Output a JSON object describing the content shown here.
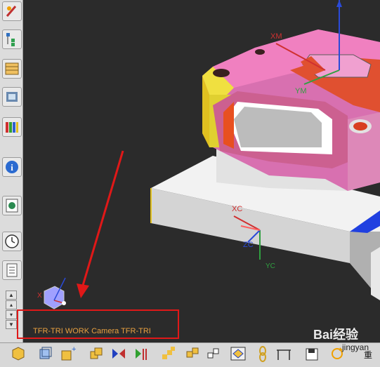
{
  "viewport": {
    "axis_labels": {
      "xm": "XM",
      "ym": "YM",
      "xc": "XC",
      "zc": "ZC",
      "yc": "YC",
      "triad_x": "X"
    },
    "status_text": "TFR-TRI WORK Camera TFR-TRI"
  },
  "left_toolbar": {
    "items": [
      "sketch-icon",
      "assembly-navigator-icon",
      "part-navigator-icon",
      "reuse-library-icon",
      "history-icon",
      "roles-icon",
      "info-icon",
      "web-browser-icon",
      "clock-icon",
      "system-materials-icon"
    ]
  },
  "bottom_toolbar": {
    "items": [
      "box-icon",
      "cube-view-icon",
      "add-component-icon",
      "move-component-icon",
      "mirror-icon",
      "constraint-icon",
      "pattern-icon",
      "assembly-icon",
      "display-icon",
      "chain-icon",
      "measure-icon",
      "refresh-icon"
    ],
    "partial_label": "重"
  },
  "watermark": {
    "main": "Bai经验",
    "sub": "jingyan"
  },
  "colors": {
    "highlight_box": "#e01818",
    "status_text": "#e8a040",
    "viewport_bg": "#2b2b2b"
  }
}
